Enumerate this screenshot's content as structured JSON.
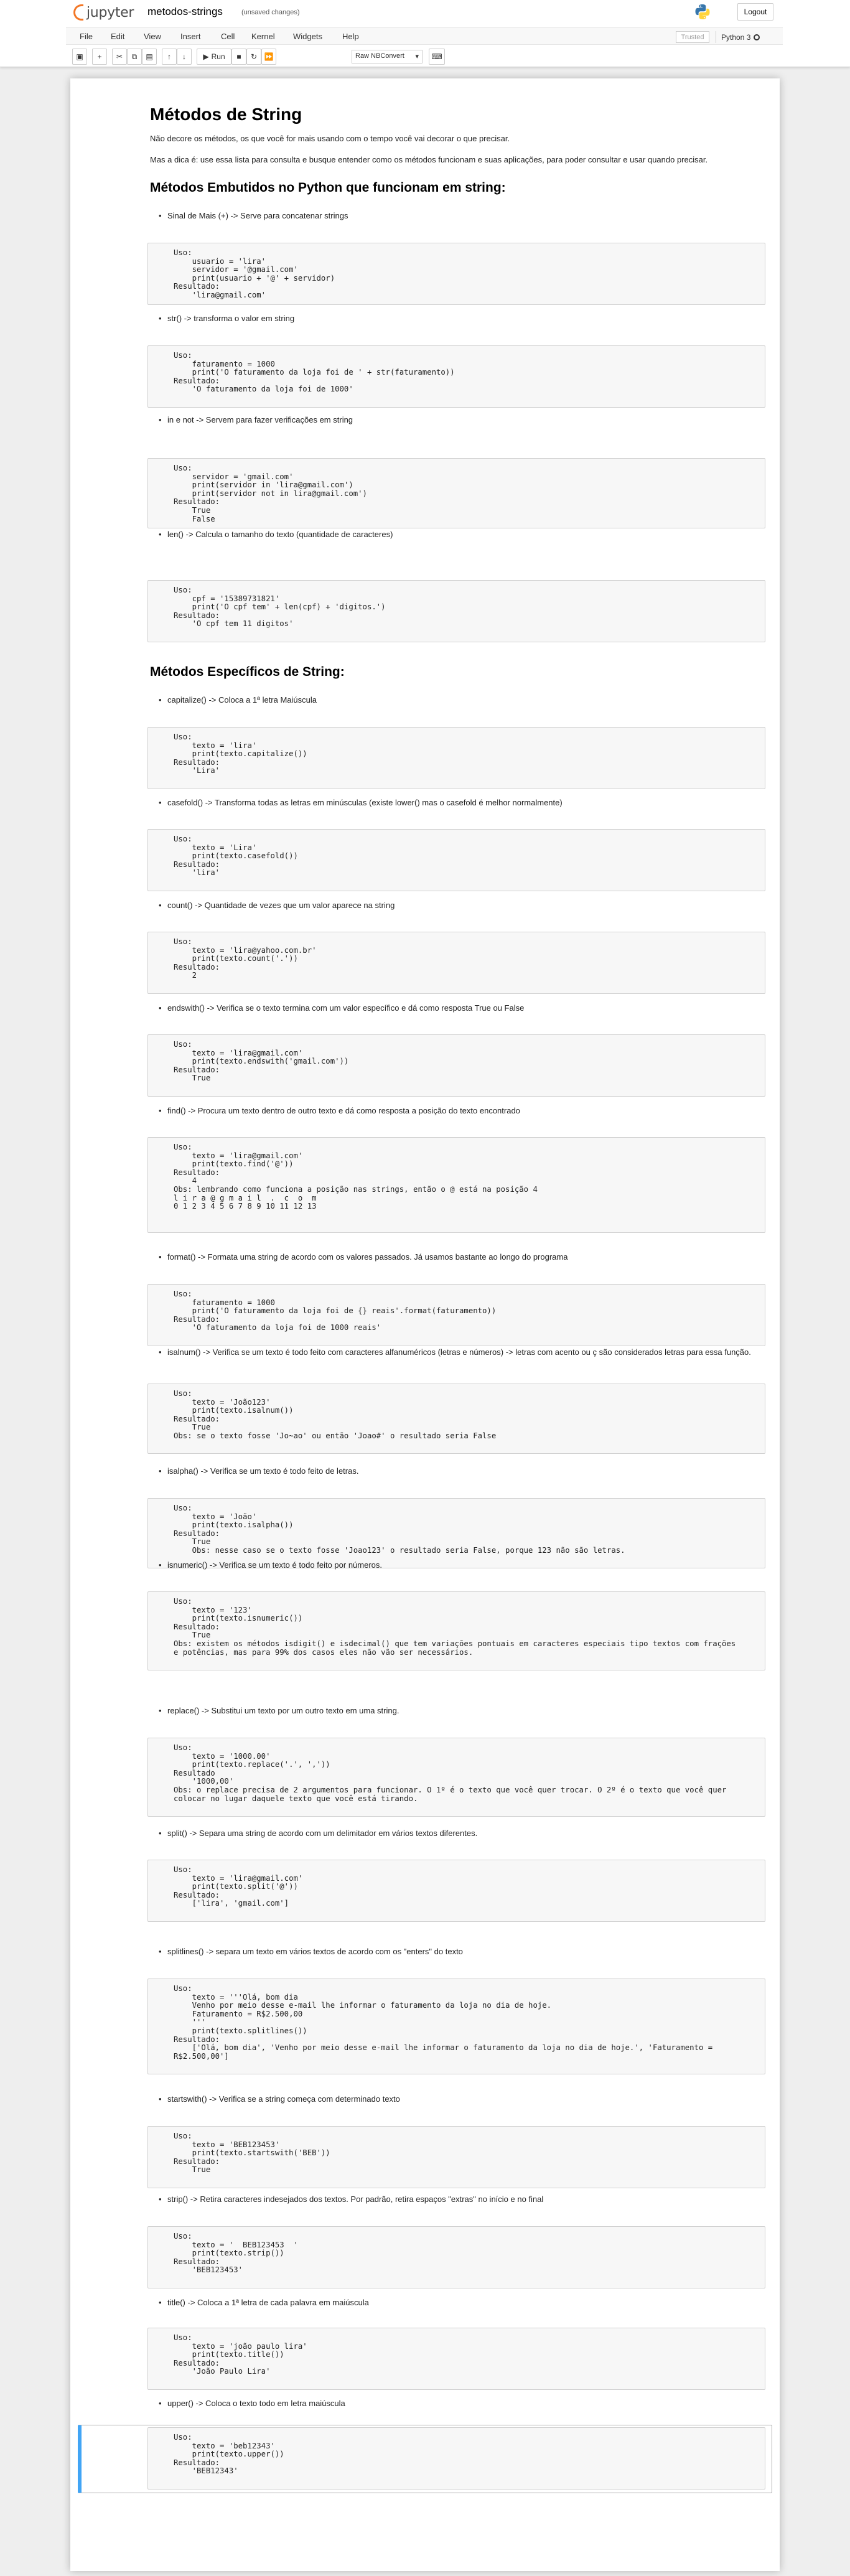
{
  "header": {
    "logo_text": "jupyter",
    "notebook_name": "metodos-strings",
    "autosave": "(unsaved changes)",
    "logout": "Logout"
  },
  "menubar": {
    "items": [
      "File",
      "Edit",
      "View",
      "Insert",
      "Cell",
      "Kernel",
      "Widgets",
      "Help"
    ],
    "trusted": "Trusted",
    "kernel": "Python 3"
  },
  "toolbar": {
    "run": "Run",
    "cell_type": "Raw NBConvert"
  },
  "notebook": {
    "title": "Métodos de String",
    "intro1": "Não decore os métodos, os que você for mais usando com o tempo você vai decorar o que precisar.",
    "intro2": "Mas a dica é: use essa lista para consulta e busque entender como os métodos funcionam e suas aplicações, para poder consultar e usar quando precisar.",
    "section1": "Métodos Embutidos no Python que funcionam em string:",
    "section2": "Métodos Específicos de String:",
    "items": [
      {
        "text": "Sinal de Mais (+) -> Serve para concatenar strings",
        "code": "Uso:\n    usuario = 'lira'\n    servidor = '@gmail.com'\n    print(usuario + '@' + servidor)\nResultado:\n    'lira@gmail.com'"
      },
      {
        "text": "str() -> transforma o valor em string",
        "code": "Uso:\n    faturamento = 1000\n    print('O faturamento da loja foi de ' + str(faturamento))\nResultado:\n    'O faturamento da loja foi de 1000'"
      },
      {
        "text": "in e not -> Servem para fazer verificações em string",
        "code": "Uso:\n    servidor = 'gmail.com'\n    print(servidor in 'lira@gmail.com')\n    print(servidor not in lira@gmail.com')\nResultado:\n    True\n    False"
      },
      {
        "text": "len() -> Calcula o tamanho do texto (quantidade de caracteres)",
        "code": "Uso:\n    cpf = '15389731821'\n    print('O cpf tem' + len(cpf) + 'digitos.')\nResultado:\n    'O cpf tem 11 digitos'"
      },
      {
        "text": "capitalize() -> Coloca a 1ª letra Maiúscula",
        "code": "Uso:\n    texto = 'lira'\n    print(texto.capitalize())\nResultado:\n    'Lira'"
      },
      {
        "text": "casefold() -> Transforma todas as letras em minúsculas (existe lower() mas o casefold é melhor normalmente)",
        "code": "Uso:\n    texto = 'Lira'\n    print(texto.casefold())\nResultado:\n    'lira'"
      },
      {
        "text": "count() -> Quantidade de vezes que um valor aparece na string",
        "code": "Uso:\n    texto = 'lira@yahoo.com.br'\n    print(texto.count('.'))\nResultado:\n    2"
      },
      {
        "text": "endswith() -> Verifica se o texto termina com um valor específico e dá como resposta True ou False",
        "code": "Uso:\n    texto = 'lira@gmail.com'\n    print(texto.endswith('gmail.com'))\nResultado:\n    True"
      },
      {
        "text": "find() -> Procura um texto dentro de outro texto e dá como resposta a posição do texto encontrado",
        "code": "Uso:\n    texto = 'lira@gmail.com'\n    print(texto.find('@'))\nResultado:\n    4\nObs: lembrando como funciona a posição nas strings, então o @ está na posição 4\nl i r a @ g m a i l  .  c  o  m\n0 1 2 3 4 5 6 7 8 9 10 11 12 13"
      },
      {
        "text": "format() -> Formata uma string de acordo com os valores passados. Já usamos bastante ao longo do programa",
        "code": "Uso:\n    faturamento = 1000\n    print('O faturamento da loja foi de {} reais'.format(faturamento))\nResultado:\n    'O faturamento da loja foi de 1000 reais'"
      },
      {
        "text": "isalnum() -> Verifica se um texto é todo feito com caracteres alfanuméricos (letras e números) -> letras com acento ou ç são considerados letras para essa função.",
        "code": "Uso:\n    texto = 'João123'\n    print(texto.isalnum())\nResultado:\n    True\nObs: se o texto fosse 'Jo~ao' ou então 'Joao#' o resultado seria False"
      },
      {
        "text": "isalpha() -> Verifica se um texto é todo feito de letras.",
        "code": "Uso:\n    texto = 'João'\n    print(texto.isalpha())\nResultado:\n    True\n    Obs: nesse caso se o texto fosse 'Joao123' o resultado seria False, porque 123 não são letras."
      },
      {
        "text": "isnumeric() -> Verifica se um texto é todo feito por números.",
        "code": "Uso:\n    texto = '123'\n    print(texto.isnumeric())\nResultado:\n    True\nObs: existem os métodos isdigit() e isdecimal() que tem variações pontuais em caracteres especiais tipo textos com frações\ne potências, mas para 99% dos casos eles não vão ser necessários."
      },
      {
        "text": "replace() -> Substitui um texto por um outro texto em uma string.",
        "code": "Uso:\n    texto = '1000.00'\n    print(texto.replace('.', ','))\nResultado\n    '1000,00'\nObs: o replace precisa de 2 argumentos para funcionar. O 1º é o texto que você quer trocar. O 2º é o texto que você quer\ncolocar no lugar daquele texto que você está tirando."
      },
      {
        "text": "split() -> Separa uma string de acordo com um delimitador em vários textos diferentes.",
        "code": "Uso:\n    texto = 'lira@gmail.com'\n    print(texto.split('@'))\nResultado:\n    ['lira', 'gmail.com']"
      },
      {
        "text": "splitlines() -> separa um texto em vários textos de acordo com os \"enters\" do texto",
        "code": "Uso:\n    texto = '''Olá, bom dia\n    Venho por meio desse e-mail lhe informar o faturamento da loja no dia de hoje.\n    Faturamento = R$2.500,00\n    '''\n    print(texto.splitlines())\nResultado:\n    ['Olá, bom dia', 'Venho por meio desse e-mail lhe informar o faturamento da loja no dia de hoje.', 'Faturamento =\nR$2.500,00']"
      },
      {
        "text": "startswith() -> Verifica se a string começa com determinado texto",
        "code": "Uso:\n    texto = 'BEB123453'\n    print(texto.startswith('BEB'))\nResultado:\n    True"
      },
      {
        "text": "strip() -> Retira caracteres indesejados dos textos. Por padrão, retira espaços \"extras\" no início e no final",
        "code": "Uso:\n    texto = '  BEB123453  '\n    print(texto.strip())\nResultado:\n    'BEB123453'"
      },
      {
        "text": "title() -> Coloca a 1ª letra de cada palavra em maiúscula",
        "code": "Uso:\n    texto = 'joão paulo lira'\n    print(texto.title())\nResultado:\n    'João Paulo Lira'"
      },
      {
        "text": "upper() -> Coloca o texto todo em letra maiúscula",
        "code": "Uso:\n    texto = 'beb12343'\n    print(texto.upper())\nResultado:\n    'BEB12343'"
      }
    ]
  }
}
